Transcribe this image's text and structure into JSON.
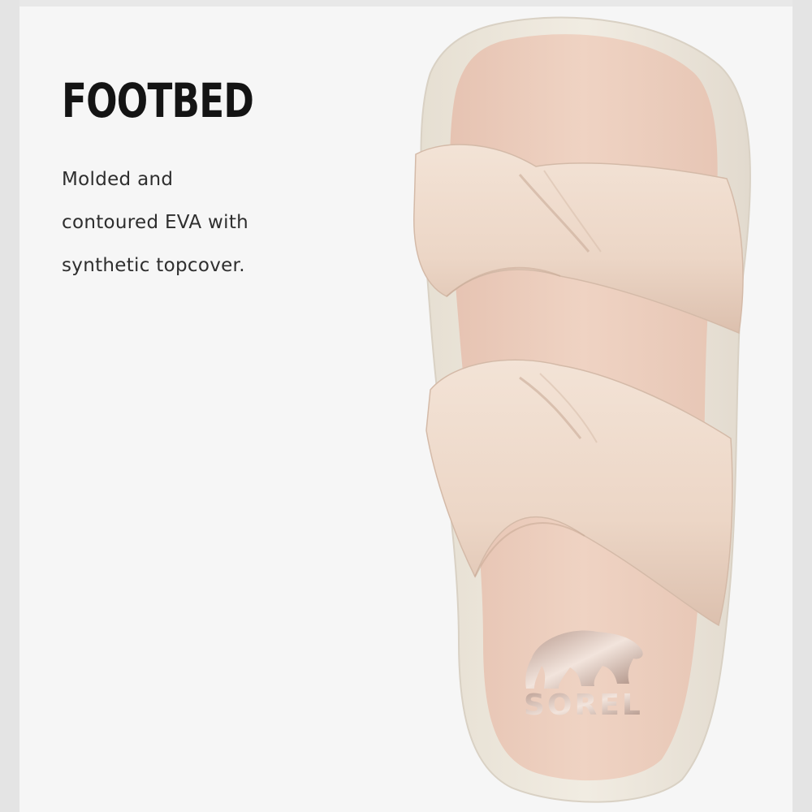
{
  "feature": {
    "title": "FOOTBED",
    "description_lines": [
      "Molded and",
      "contoured EVA with",
      "synthetic topcover."
    ]
  },
  "product_image": {
    "subject": "sandal top view",
    "brand_logo_text": "SOREL",
    "colors": {
      "background": "#f6f6f6",
      "sole": "#ece6da",
      "footbed": "#ebcdbd",
      "straps": "#f0dccd"
    }
  }
}
